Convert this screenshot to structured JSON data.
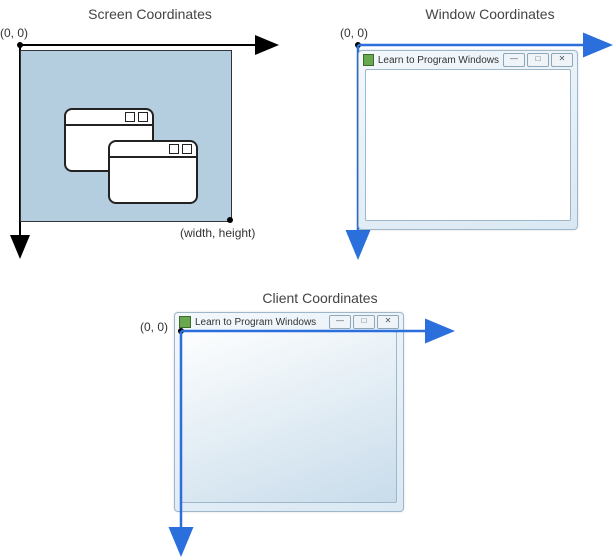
{
  "diagrams": {
    "screen": {
      "title": "Screen Coordinates",
      "origin_label": "(0, 0)",
      "extent_label": "(width, height)"
    },
    "window": {
      "title": "Window Coordinates",
      "origin_label": "(0, 0)",
      "app_title": "Learn to Program Windows",
      "buttons": {
        "minimize": "—",
        "maximize": "□",
        "close": "✕"
      }
    },
    "client": {
      "title": "Client Coordinates",
      "origin_label": "(0, 0)",
      "app_title": "Learn to Program Windows",
      "buttons": {
        "minimize": "—",
        "maximize": "□",
        "close": "✕"
      }
    }
  },
  "colors": {
    "axis_black": "#000000",
    "axis_blue": "#2a6fdb",
    "screen_fill": "#b4cee0"
  }
}
